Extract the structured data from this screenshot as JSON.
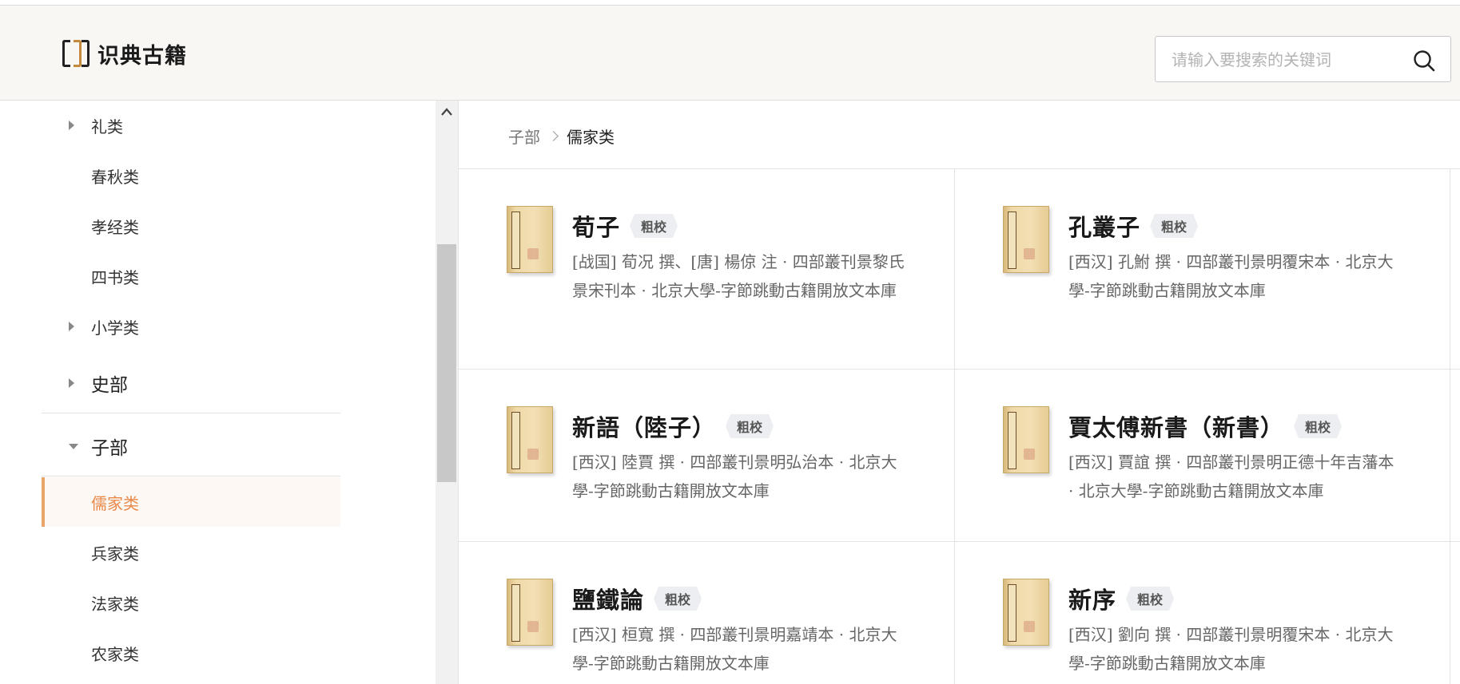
{
  "header": {
    "logo_text": "识典古籍",
    "search_placeholder": "请输入要搜索的关键词"
  },
  "sidebar": {
    "items": [
      {
        "label": "礼类",
        "caret": "right"
      },
      {
        "label": "春秋类",
        "caret": "none"
      },
      {
        "label": "孝经类",
        "caret": "none"
      },
      {
        "label": "四书类",
        "caret": "none"
      },
      {
        "label": "小学类",
        "caret": "right"
      },
      {
        "label": "史部",
        "caret": "right"
      },
      {
        "label": "子部",
        "caret": "down"
      },
      {
        "label": "儒家类",
        "caret": "none",
        "active": true
      },
      {
        "label": "兵家类",
        "caret": "none"
      },
      {
        "label": "法家类",
        "caret": "none"
      },
      {
        "label": "农家类",
        "caret": "none"
      }
    ]
  },
  "breadcrumb": {
    "parent": "子部",
    "current": "儒家类"
  },
  "books": [
    {
      "title": "荀子",
      "badge": "粗校",
      "meta": "[战国] 荀况 撰、[唐] 楊倞 注 · 四部叢刊景黎氏景宋刊本 · 北京大學-字節跳動古籍開放文本庫"
    },
    {
      "title": "孔叢子",
      "badge": "粗校",
      "meta": "[西汉] 孔鮒 撰 · 四部叢刊景明覆宋本 · 北京大學-字節跳動古籍開放文本庫"
    },
    {
      "title": "新語（陸子）",
      "badge": "粗校",
      "meta": "[西汉] 陸賈 撰 · 四部叢刊景明弘治本 · 北京大學-字節跳動古籍開放文本庫"
    },
    {
      "title": "賈太傅新書（新書）",
      "badge": "粗校",
      "meta": "[西汉] 賈誼 撰 · 四部叢刊景明正德十年吉藩本 · 北京大學-字節跳動古籍開放文本庫"
    },
    {
      "title": "鹽鐵論",
      "badge": "粗校",
      "meta": "[西汉] 桓寬 撰 · 四部叢刊景明嘉靖本 · 北京大學-字節跳動古籍開放文本庫"
    },
    {
      "title": "新序",
      "badge": "粗校",
      "meta": "[西汉] 劉向 撰 · 四部叢刊景明覆宋本 · 北京大學-字節跳動古籍開放文本庫"
    }
  ]
}
